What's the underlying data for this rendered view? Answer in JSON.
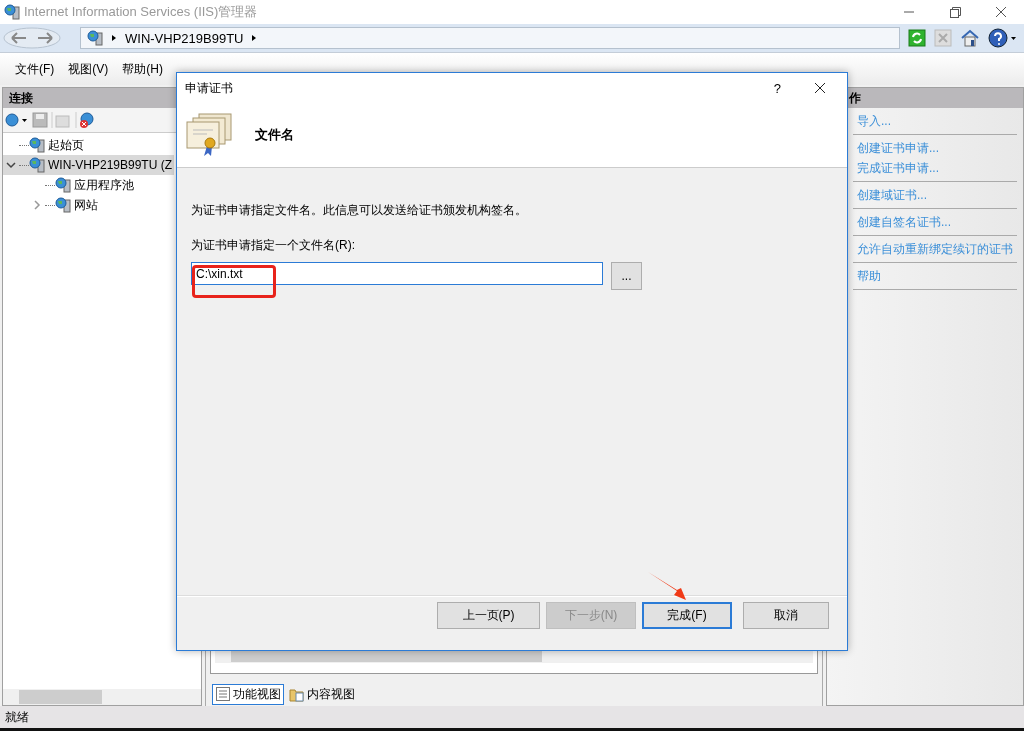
{
  "window": {
    "title": "Internet Information Services (IIS)管理器"
  },
  "address_bar": {
    "segments": [
      "WIN-VHP219B99TU"
    ]
  },
  "menu": [
    "文件(F)",
    "视图(V)",
    "帮助(H)"
  ],
  "connections": {
    "title": "连接",
    "tree": [
      {
        "label": "起始页",
        "selected": false
      },
      {
        "label": "WIN-VHP219B99TU (Z",
        "selected": true,
        "expanded": true,
        "children": [
          {
            "label": "应用程序池",
            "selected": false
          },
          {
            "label": "网站",
            "selected": false,
            "expanded": false
          }
        ]
      }
    ]
  },
  "center": {
    "view_tabs": [
      {
        "label": "功能视图",
        "selected": true
      },
      {
        "label": "内容视图",
        "selected": false
      }
    ]
  },
  "actions": {
    "title": "作",
    "groups": [
      {
        "items": [
          "导入..."
        ]
      },
      {
        "items": [
          "创建证书申请...",
          "完成证书申请..."
        ]
      },
      {
        "items": [
          "创建域证书..."
        ]
      },
      {
        "items": [
          "创建自签名证书..."
        ]
      },
      {
        "items": [
          "允许自动重新绑定续订的证书"
        ]
      },
      {
        "items": [
          "帮助"
        ]
      }
    ]
  },
  "status_bar": "就绪",
  "dialog": {
    "title": "申请证书",
    "help": "?",
    "heading": "文件名",
    "description": "为证书申请指定文件名。此信息可以发送给证书颁发机构签名。",
    "field_label": "为证书申请指定一个文件名(R):",
    "field_value": "C:\\xin.txt",
    "browse": "...",
    "buttons": [
      {
        "label": "上一页(P)",
        "disabled": false,
        "default": false
      },
      {
        "label": "下一步(N)",
        "disabled": true,
        "default": false
      },
      {
        "label": "完成(F)",
        "disabled": false,
        "default": true
      },
      {
        "label": "取消",
        "disabled": false,
        "default": false
      }
    ]
  }
}
